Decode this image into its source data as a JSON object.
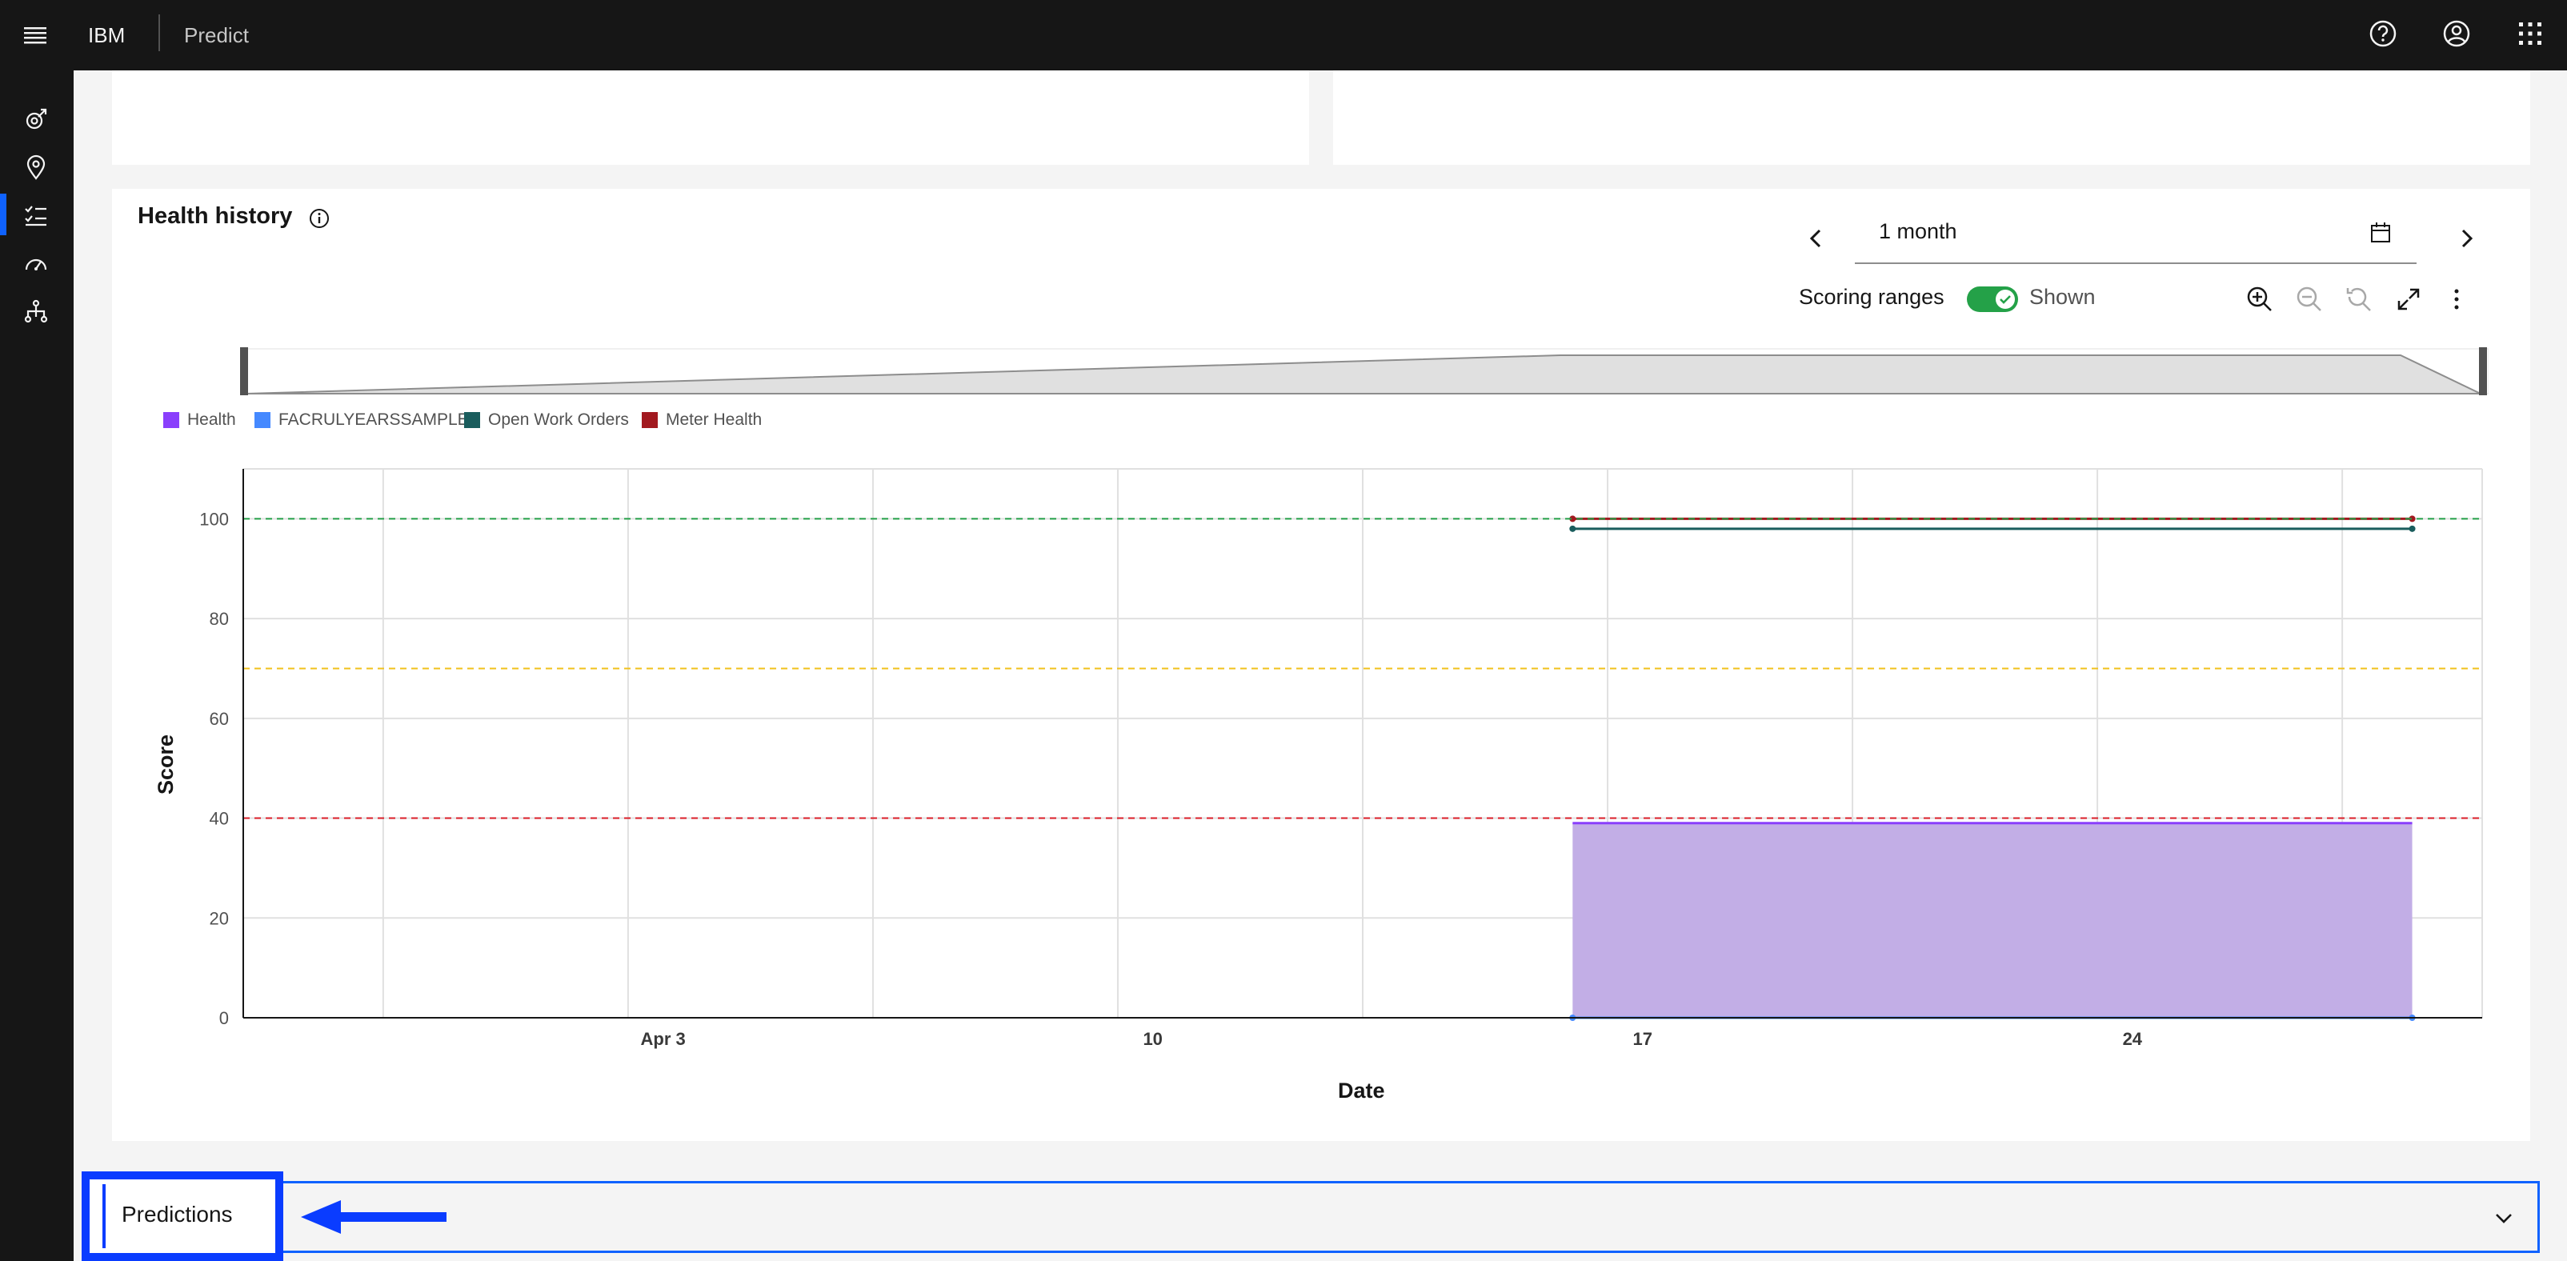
{
  "header": {
    "brand": "IBM",
    "product": "Predict",
    "icons": [
      "menu-icon",
      "help-icon",
      "user-icon",
      "app-switcher-icon"
    ]
  },
  "sidenav": {
    "items": [
      {
        "icon": "satellite-icon",
        "active": false
      },
      {
        "icon": "location-icon",
        "active": false
      },
      {
        "icon": "checklist-icon",
        "active": true
      },
      {
        "icon": "dashboard-gauge-icon",
        "active": false
      },
      {
        "icon": "hierarchy-icon",
        "active": false
      }
    ]
  },
  "health_history": {
    "title": "Health history",
    "date_range": "1 month",
    "scoring_ranges_label": "Scoring ranges",
    "scoring_ranges_state": "Shown",
    "toggle_on": true
  },
  "colors": {
    "health": "#8a3ffc",
    "facrulyearssample": "#4589ff",
    "open_work_orders": "#1a5d5d",
    "meter_health": "#a2191f",
    "range_good": "#24a148",
    "range_fair": "#f1c21b",
    "range_poor": "#da1e28"
  },
  "chart_data": {
    "type": "area",
    "title": "",
    "xlabel": "Date",
    "ylabel": "Score",
    "ylim": [
      0,
      110
    ],
    "yticks": [
      0,
      20,
      40,
      60,
      80,
      100
    ],
    "x_range": [
      "2024-03-28",
      "2024-04-29"
    ],
    "xtick_labels": [
      {
        "date": "2024-04-03",
        "label": "Apr 3"
      },
      {
        "date": "2024-04-10",
        "label": "10"
      },
      {
        "date": "2024-04-17",
        "label": "17"
      },
      {
        "date": "2024-04-24",
        "label": "24"
      }
    ],
    "scoring_ranges": [
      {
        "value": 100,
        "color": "#24a148"
      },
      {
        "value": 70,
        "color": "#f1c21b"
      },
      {
        "value": 40,
        "color": "#da1e28"
      }
    ],
    "legend": [
      "Health",
      "FACRULYEARSSAMPLE",
      "Open Work Orders",
      "Meter Health"
    ],
    "series": [
      {
        "name": "Health",
        "type": "area",
        "x": [
          "2024-04-16",
          "2024-04-28"
        ],
        "values": [
          39,
          39
        ]
      },
      {
        "name": "FACRULYEARSSAMPLE",
        "type": "line",
        "x": [
          "2024-04-16",
          "2024-04-28"
        ],
        "values": [
          0,
          0
        ]
      },
      {
        "name": "Open Work Orders",
        "type": "line",
        "x": [
          "2024-04-16",
          "2024-04-28"
        ],
        "values": [
          98,
          98
        ]
      },
      {
        "name": "Meter Health",
        "type": "line",
        "x": [
          "2024-04-16",
          "2024-04-28"
        ],
        "values": [
          100,
          100
        ]
      }
    ]
  },
  "predictions": {
    "label": "Predictions"
  }
}
